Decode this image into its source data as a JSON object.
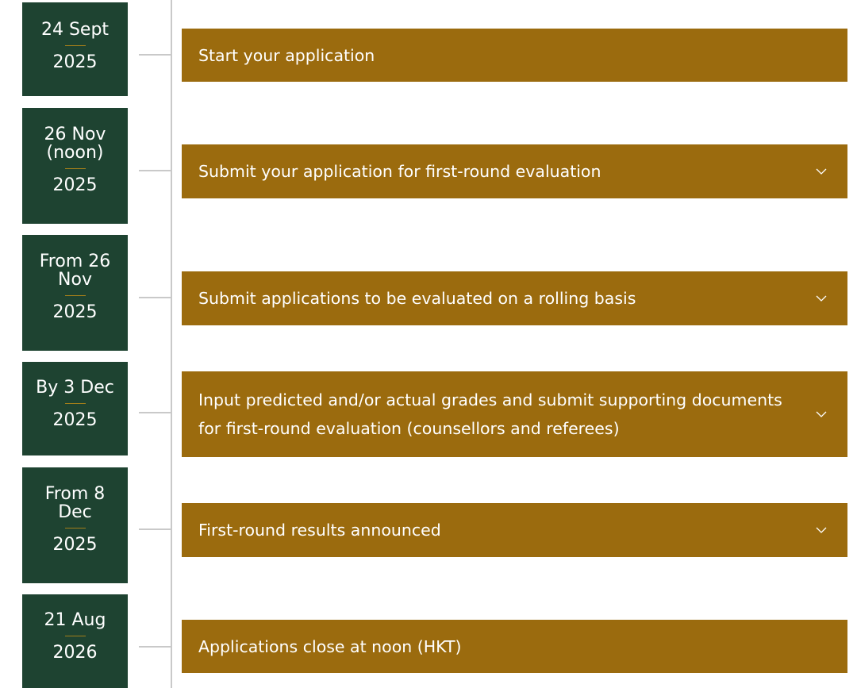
{
  "timeline": {
    "stages": [
      {
        "date_main": "24 Sept",
        "year": "2025",
        "label": "Start your application",
        "expandable": false
      },
      {
        "date_main": "26 Nov\n(noon)",
        "year": "2025",
        "label": "Submit your application for first-round evaluation",
        "expandable": true
      },
      {
        "date_main": "From 26\nNov",
        "year": "2025",
        "label": "Submit applications to be evaluated on a rolling basis",
        "expandable": true
      },
      {
        "date_main": "By 3 Dec",
        "year": "2025",
        "label": "Input predicted and/or actual grades and submit supporting documents for first-round evaluation (counsellors and referees)",
        "expandable": true
      },
      {
        "date_main": "From 8\nDec",
        "year": "2025",
        "label": "First-round results announced",
        "expandable": true
      },
      {
        "date_main": "21 Aug",
        "year": "2026",
        "label": "Applications close at noon (HKT)",
        "expandable": false
      }
    ]
  },
  "colors": {
    "date_box_bg": "#1e4331",
    "stage_bar_bg": "#9b6b0e",
    "separator_gold": "#a37e1a",
    "timeline_line": "#c9c9c9"
  },
  "icons": {
    "expand": "chevron-down-icon"
  }
}
